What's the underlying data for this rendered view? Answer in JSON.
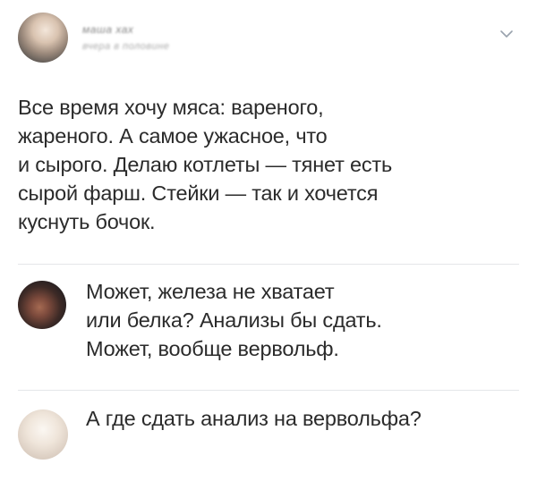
{
  "post": {
    "author_name": "маша хах",
    "date": "вчера в половине",
    "text": "Все время хочу мяса: вареного,\nжареного. А самое ужасное, что\nи сырого. Делаю котлеты — тянет есть\nсырой фарш. Стейки — так и хочется\nкуснуть бочок."
  },
  "comments": [
    {
      "text": "Может, железа не хватает\nили белка? Анализы бы сдать.\nМожет, вообще вервольф."
    },
    {
      "text": "А где сдать анализ на вервольфа?"
    }
  ],
  "icons": {
    "post_menu": "chevron-down-icon"
  },
  "colors": {
    "text": "#2b2b2b",
    "divider": "#e4e6e9",
    "chevron": "#99a2ad"
  }
}
